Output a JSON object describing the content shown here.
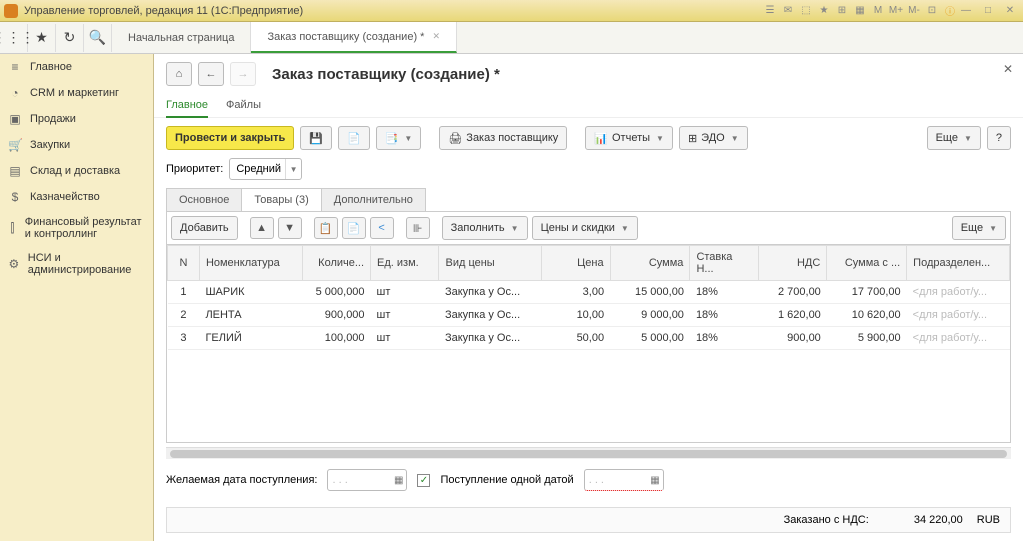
{
  "window": {
    "title": "Управление торговлей, редакция 11  (1С:Предприятие)"
  },
  "top_tabs": {
    "start": "Начальная страница",
    "doc": "Заказ поставщику (создание) *"
  },
  "sidebar": [
    {
      "icon": "≡",
      "label": "Главное"
    },
    {
      "icon": "◔",
      "label": "CRM и маркетинг"
    },
    {
      "icon": "▣",
      "label": "Продажи"
    },
    {
      "icon": "🛒",
      "label": "Закупки"
    },
    {
      "icon": "▤",
      "label": "Склад и доставка"
    },
    {
      "icon": "$",
      "label": "Казначейство"
    },
    {
      "icon": "⫿",
      "label": "Финансовый результат и контроллинг"
    },
    {
      "icon": "⚙",
      "label": "НСИ и администрирование"
    }
  ],
  "page": {
    "title": "Заказ поставщику (создание) *",
    "sub_main": "Главное",
    "sub_files": "Файлы"
  },
  "cmd": {
    "post_close": "Провести и закрыть",
    "order": "Заказ поставщику",
    "reports": "Отчеты",
    "edo": "ЭДО",
    "more": "Еще"
  },
  "priority": {
    "label": "Приоритет:",
    "value": "Средний"
  },
  "sec_tabs": {
    "main": "Основное",
    "goods": "Товары (3)",
    "extra": "Дополнительно"
  },
  "gridbar": {
    "add": "Добавить",
    "fill": "Заполнить",
    "prices": "Цены и скидки",
    "more": "Еще"
  },
  "cols": {
    "n": "N",
    "nomen": "Номенклатура",
    "qty": "Количе...",
    "unit": "Ед. изм.",
    "ptype": "Вид цены",
    "price": "Цена",
    "sum": "Сумма",
    "rate": "Ставка Н...",
    "vat": "НДС",
    "sumvat": "Сумма с ...",
    "dept": "Подразделен..."
  },
  "rows": [
    {
      "n": "1",
      "nomen": "ШАРИК",
      "qty": "5 000,000",
      "unit": "шт",
      "ptype": "Закупка у Ос...",
      "price": "3,00",
      "sum": "15 000,00",
      "rate": "18%",
      "vat": "2 700,00",
      "sumvat": "17 700,00",
      "dept": "<для работ/у..."
    },
    {
      "n": "2",
      "nomen": "ЛЕНТА",
      "qty": "900,000",
      "unit": "шт",
      "ptype": "Закупка у Ос...",
      "price": "10,00",
      "sum": "9 000,00",
      "rate": "18%",
      "vat": "1 620,00",
      "sumvat": "10 620,00",
      "dept": "<для работ/у..."
    },
    {
      "n": "3",
      "nomen": "ГЕЛИЙ",
      "qty": "100,000",
      "unit": "шт",
      "ptype": "Закупка у Ос...",
      "price": "50,00",
      "sum": "5 000,00",
      "rate": "18%",
      "vat": "900,00",
      "sumvat": "5 900,00",
      "dept": "<для работ/у..."
    }
  ],
  "dates": {
    "wanted_label": "Желаемая дата поступления:",
    "placeholder": ". . .",
    "single_label": "Поступление одной датой"
  },
  "footer": {
    "label": "Заказано с НДС:",
    "value": "34 220,00",
    "cur": "RUB"
  }
}
